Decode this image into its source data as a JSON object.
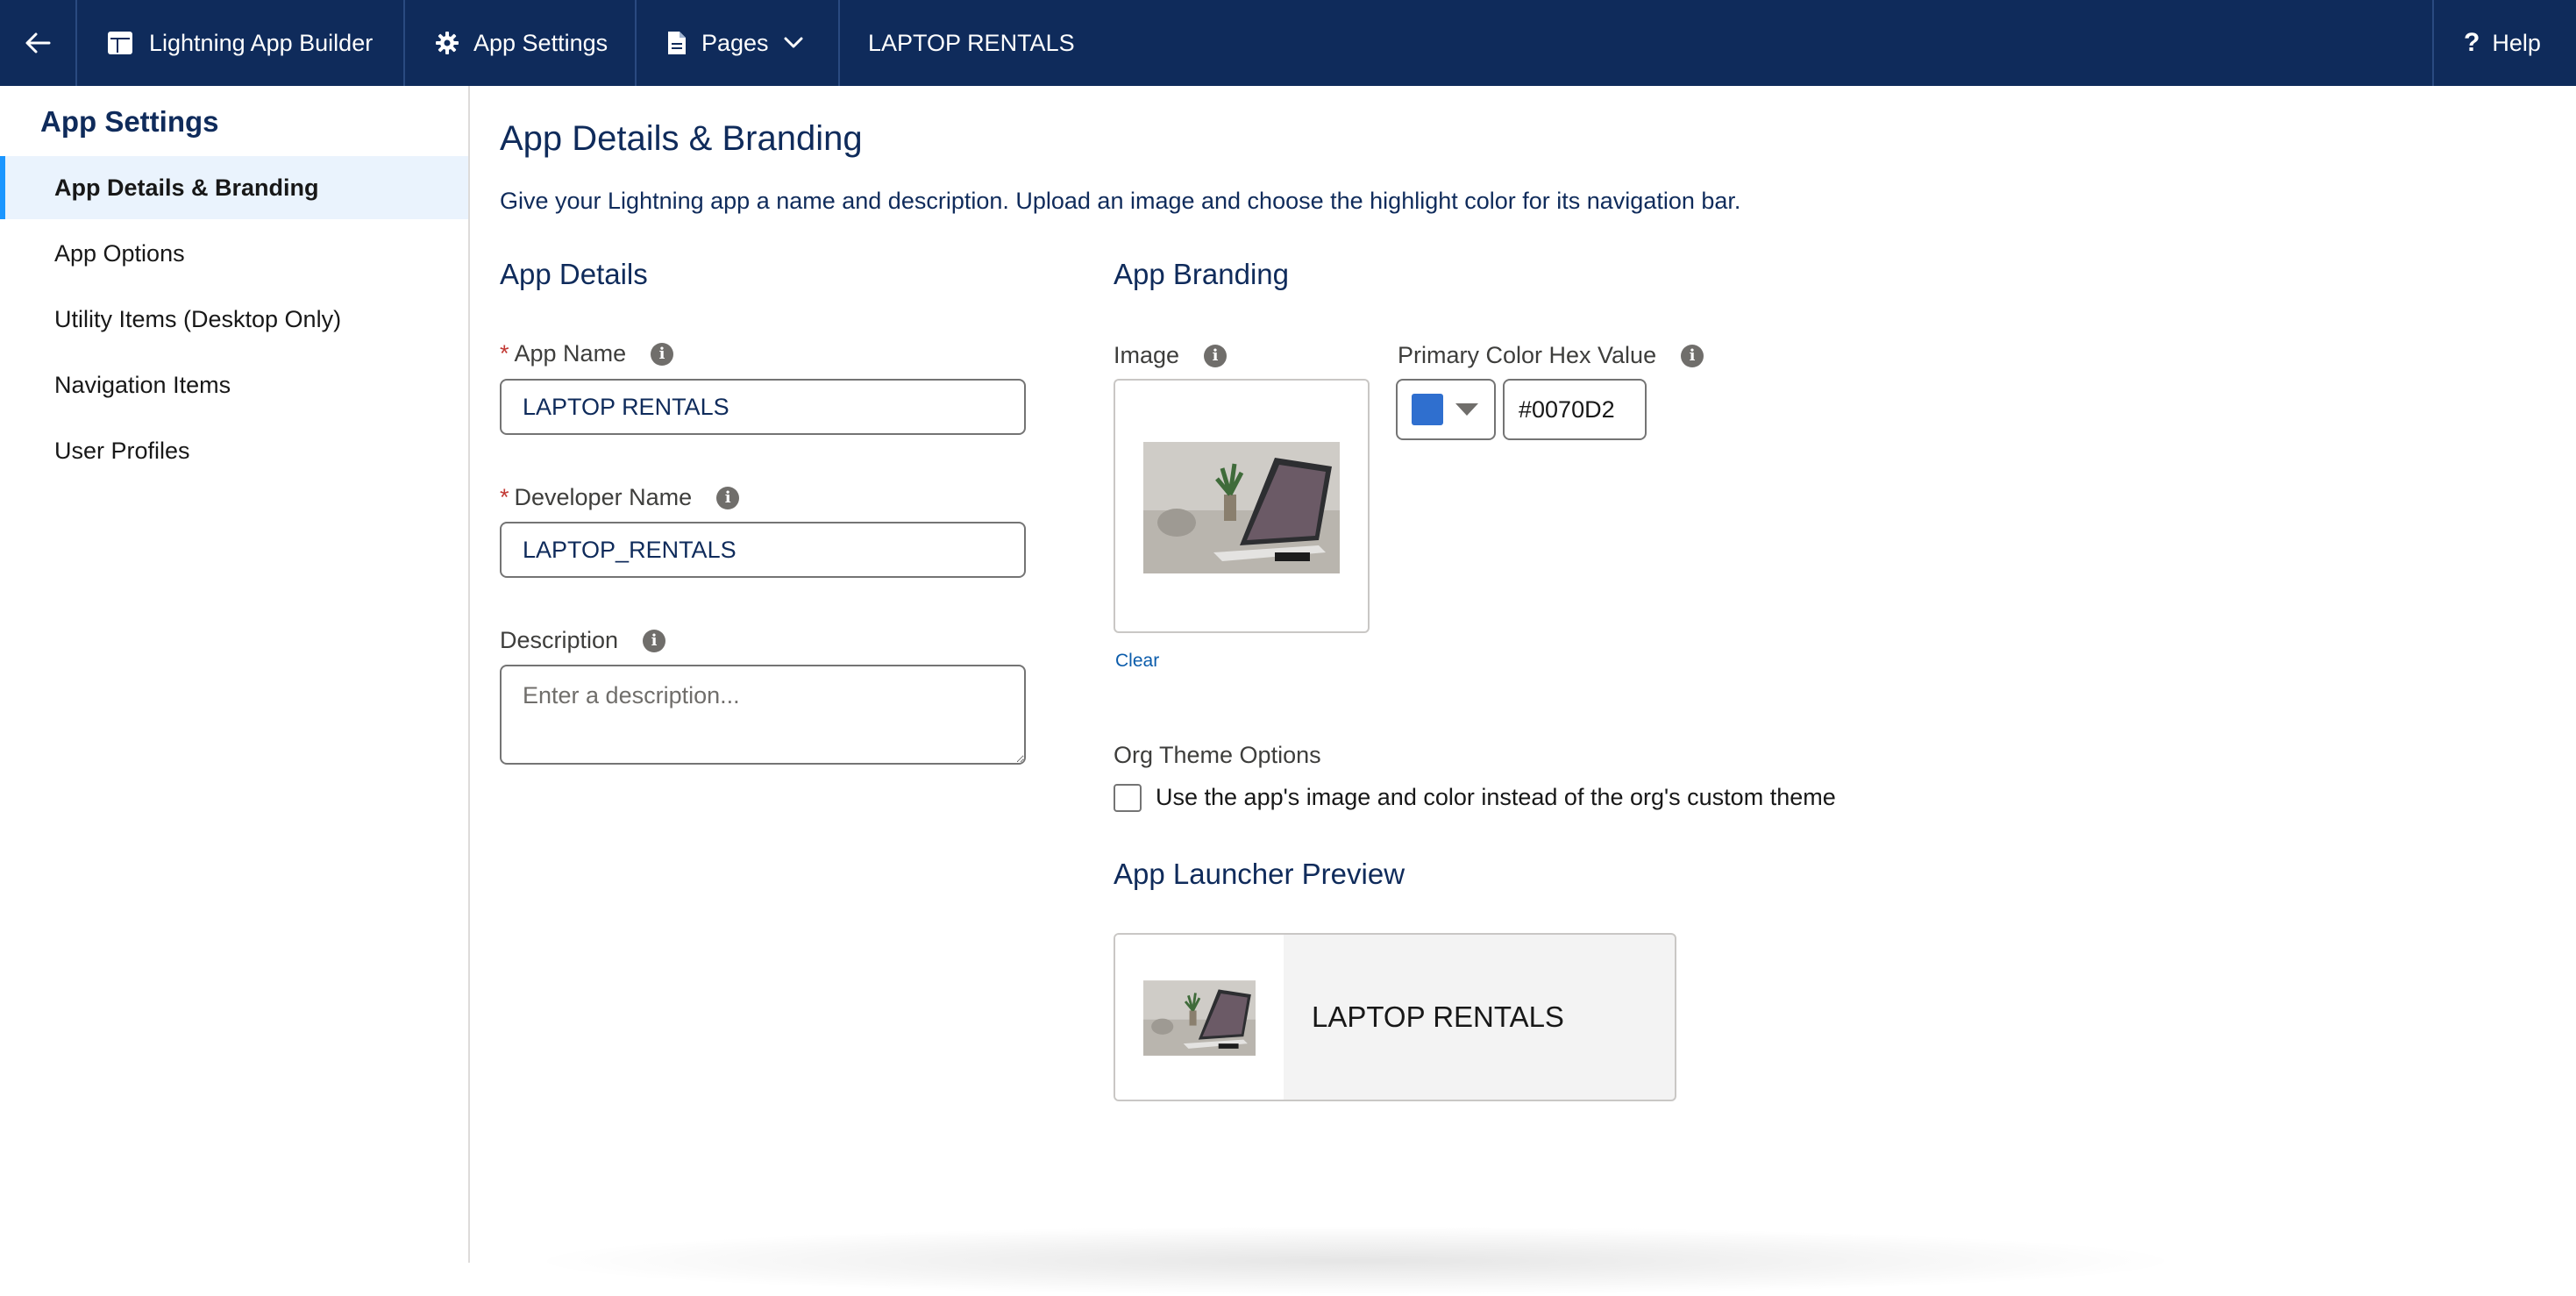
{
  "topbar": {
    "back_icon": "arrow-left-icon",
    "builder_label": "Lightning App Builder",
    "settings_label": "App Settings",
    "pages_label": "Pages",
    "app_title": "LAPTOP RENTALS",
    "help_label": "Help"
  },
  "sidebar": {
    "heading": "App Settings",
    "items": [
      {
        "label": "App Details & Branding",
        "active": true
      },
      {
        "label": "App Options"
      },
      {
        "label": "Utility Items (Desktop Only)"
      },
      {
        "label": "Navigation Items"
      },
      {
        "label": "User Profiles"
      }
    ]
  },
  "main": {
    "title": "App Details & Branding",
    "description": "Give your Lightning app a name and description. Upload an image and choose the highlight color for its navigation bar.",
    "app_details": {
      "heading": "App Details",
      "app_name_label": "App Name",
      "app_name_value": "LAPTOP RENTALS",
      "developer_name_label": "Developer Name",
      "developer_name_value": "LAPTOP_RENTALS",
      "description_label": "Description",
      "description_placeholder": "Enter a description...",
      "required_mark": "*"
    },
    "app_branding": {
      "heading": "App Branding",
      "image_label": "Image",
      "clear_label": "Clear",
      "color_label": "Primary Color Hex Value",
      "color_value": "#0070D2",
      "swatch_color": "#2f6fcf",
      "org_theme_label": "Org Theme Options",
      "org_theme_checkbox_label": "Use the app's image and color instead of the org's custom theme",
      "org_theme_checked": false
    },
    "launcher_preview": {
      "heading": "App Launcher Preview",
      "app_name": "LAPTOP RENTALS"
    }
  },
  "colors": {
    "topbar_bg": "#0f2b5b",
    "heading_text": "#0f2b5b",
    "active_accent": "#1b96ff",
    "required": "#c23934",
    "link": "#0b5cab"
  }
}
